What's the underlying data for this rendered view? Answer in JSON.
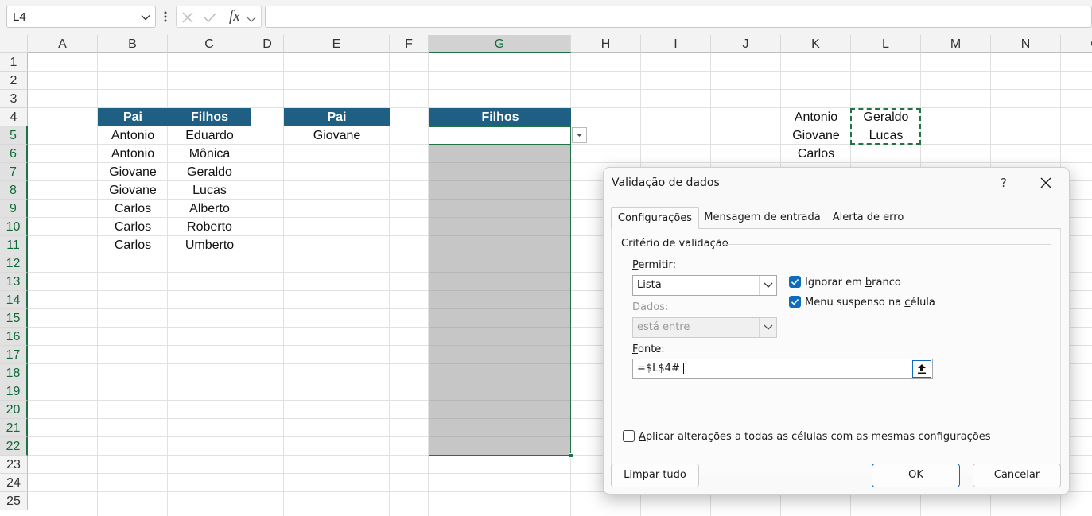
{
  "formula_bar": {
    "name_box": "L4",
    "fx": "fx",
    "formula": ""
  },
  "columns": [
    "A",
    "B",
    "C",
    "D",
    "E",
    "F",
    "G",
    "H",
    "I",
    "J",
    "K",
    "L",
    "M",
    "N",
    "O"
  ],
  "rows": [
    "1",
    "2",
    "3",
    "4",
    "5",
    "6",
    "7",
    "8",
    "9",
    "10",
    "11",
    "12",
    "13",
    "14",
    "15",
    "16",
    "17",
    "18",
    "19",
    "20",
    "21",
    "22",
    "23",
    "24",
    "25"
  ],
  "selected_column": "G",
  "table1": {
    "headers": [
      "Pai",
      "Filhos"
    ],
    "rows": [
      [
        "Antonio",
        "Eduardo"
      ],
      [
        "Antonio",
        "Mônica"
      ],
      [
        "Giovane",
        "Geraldo"
      ],
      [
        "Giovane",
        "Lucas"
      ],
      [
        "Carlos",
        "Alberto"
      ],
      [
        "Carlos",
        "Roberto"
      ],
      [
        "Carlos",
        "Umberto"
      ]
    ]
  },
  "table2": {
    "header": "Pai",
    "value": "Giovane"
  },
  "table3": {
    "header": "Filhos"
  },
  "helper": {
    "k": [
      "Antonio",
      "Giovane",
      "Carlos"
    ],
    "l": [
      "Geraldo",
      "Lucas"
    ]
  },
  "dialog": {
    "title": "Validação de dados",
    "help": "?",
    "tabs": [
      "Configurações",
      "Mensagem de entrada",
      "Alerta de erro"
    ],
    "group_label": "Critério de validação",
    "permitir_label_u": "P",
    "permitir_label_rest": "ermitir:",
    "permitir_value": "Lista",
    "dados_label": "Dados:",
    "dados_value": "está entre",
    "ignore_blank_a": "Ignorar em ",
    "ignore_blank_u": "b",
    "ignore_blank_b": "ranco",
    "dropdown_a": "Menu suspenso na ",
    "dropdown_u": "c",
    "dropdown_b": "élula",
    "fonte_label_u": "F",
    "fonte_label_rest": "onte:",
    "fonte_value": "=$L$4#",
    "apply_all_u": "A",
    "apply_all_rest": "plicar alterações a todas as células com as mesmas configurações",
    "clear_u": "L",
    "clear_rest": "impar tudo",
    "ok": "OK",
    "cancel": "Cancelar"
  },
  "colors": {
    "header_fill": "#1f5f83",
    "selection_green": "#217346",
    "range_gray": "#c6c6c6",
    "checkbox_blue": "#0f6cbd"
  }
}
